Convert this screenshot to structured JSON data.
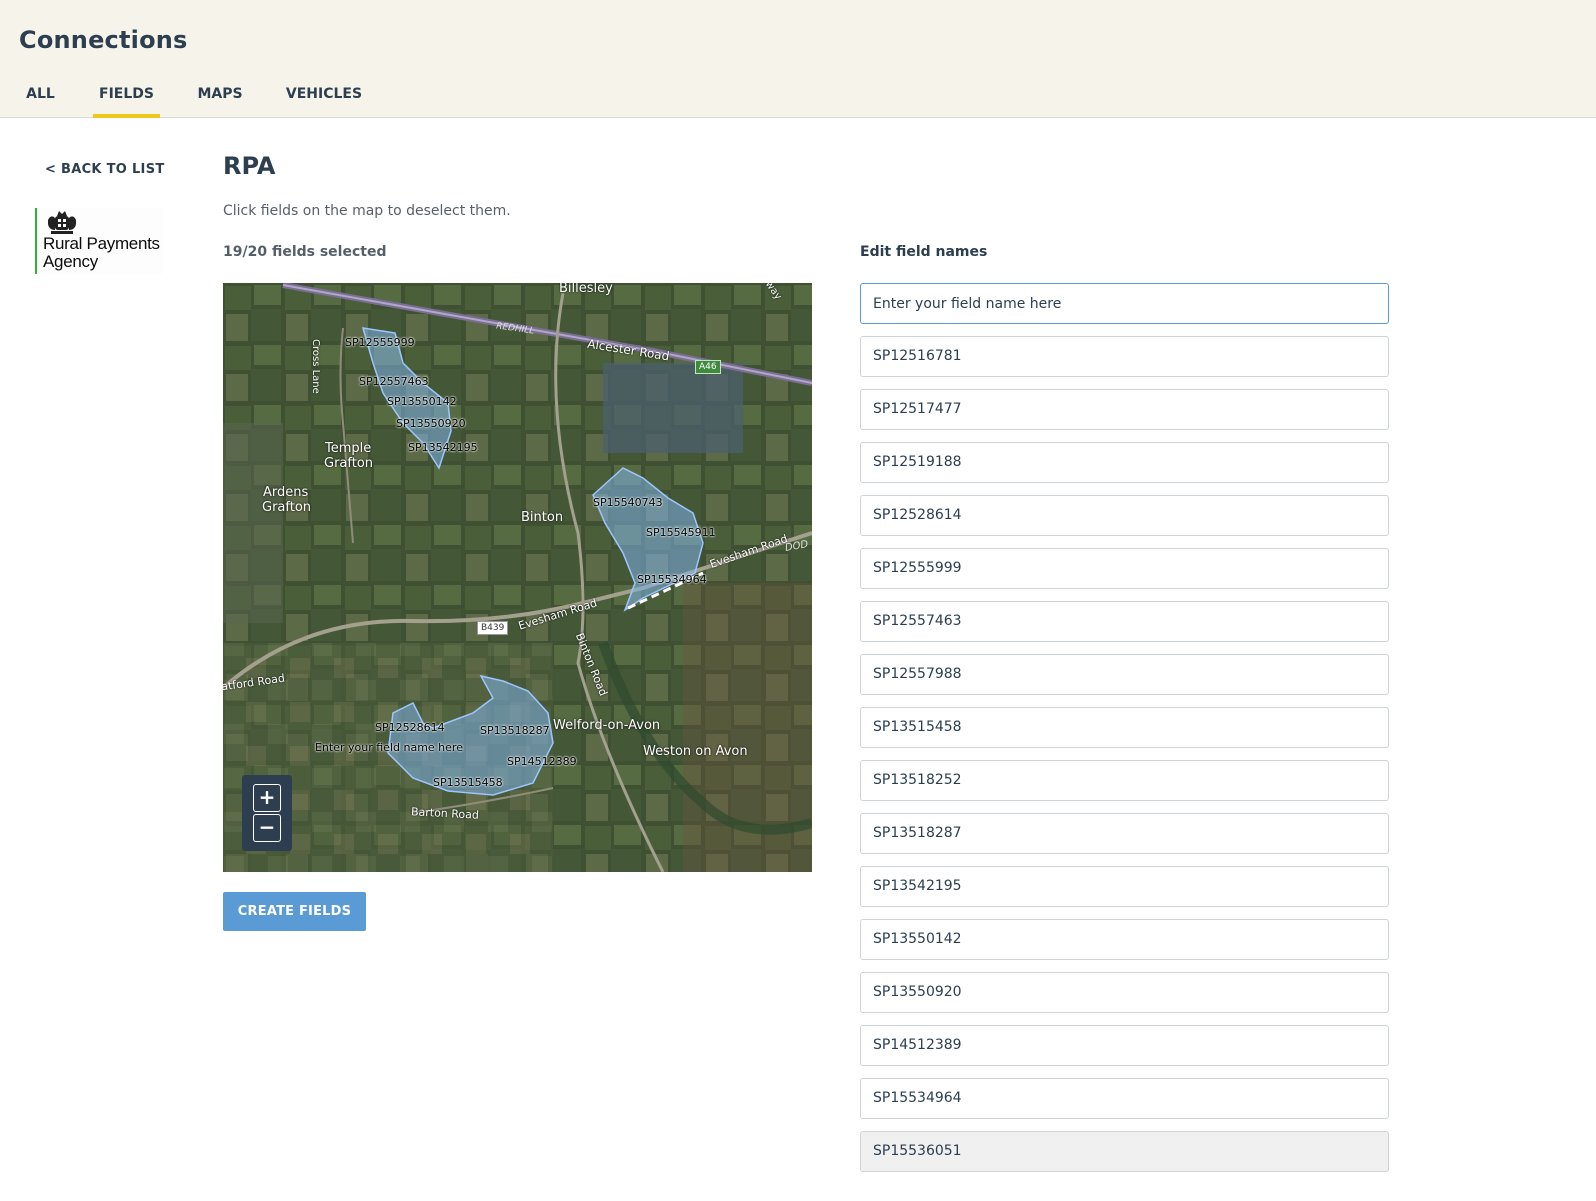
{
  "app": {
    "title": "Connections"
  },
  "tabs": [
    {
      "label": "ALL",
      "active": false
    },
    {
      "label": "FIELDS",
      "active": true
    },
    {
      "label": "MAPS",
      "active": false
    },
    {
      "label": "VEHICLES",
      "active": false
    }
  ],
  "nav": {
    "back_label": "< BACK TO LIST"
  },
  "provider": {
    "logo_line1": "Rural Payments",
    "logo_line2": "Agency"
  },
  "page": {
    "title": "RPA",
    "instructions": "Click fields on the map to deselect them.",
    "selected_count": "19/20 fields selected",
    "create_label": "CREATE FIELDS"
  },
  "map": {
    "places": [
      "Billesley",
      "Temple",
      "Grafton",
      "Ardens",
      "Grafton",
      "Binton",
      "Welford-on-Avon",
      "Weston on Avon"
    ],
    "roads": [
      "Alcester Road",
      "REDHILL",
      "A46",
      "B439",
      "Evesham Road",
      "Evesham Road",
      "Binton Road",
      "Barton Road",
      "atford Road",
      "Cross Lane",
      "way",
      "DOD"
    ],
    "field_labels": [
      "SP12555999",
      "SP12557463",
      "SP13550142",
      "SP13550920",
      "SP13542195",
      "SP15540743",
      "SP15545911",
      "SP15534964",
      "SP12528614",
      "Enter your field name here",
      "SP13518287",
      "SP14512389",
      "SP13515458"
    ],
    "zoom_in": "+",
    "zoom_out": "−"
  },
  "editor": {
    "heading": "Edit field names",
    "new_field": {
      "value": "Enter your field name here"
    },
    "fields": [
      "SP12516781",
      "SP12517477",
      "SP12519188",
      "SP12528614",
      "SP12555999",
      "SP12557463",
      "SP12557988",
      "SP13515458",
      "SP13518252",
      "SP13518287",
      "SP13542195",
      "SP13550142",
      "SP13550920",
      "SP14512389",
      "SP15534964",
      "SP15536051"
    ],
    "disabled_field": "SP15536051"
  },
  "colors": {
    "accent": "#f2c71b",
    "button": "#5b9bd5",
    "text": "#2c3e50",
    "field_fill": "#7fb0e6"
  }
}
